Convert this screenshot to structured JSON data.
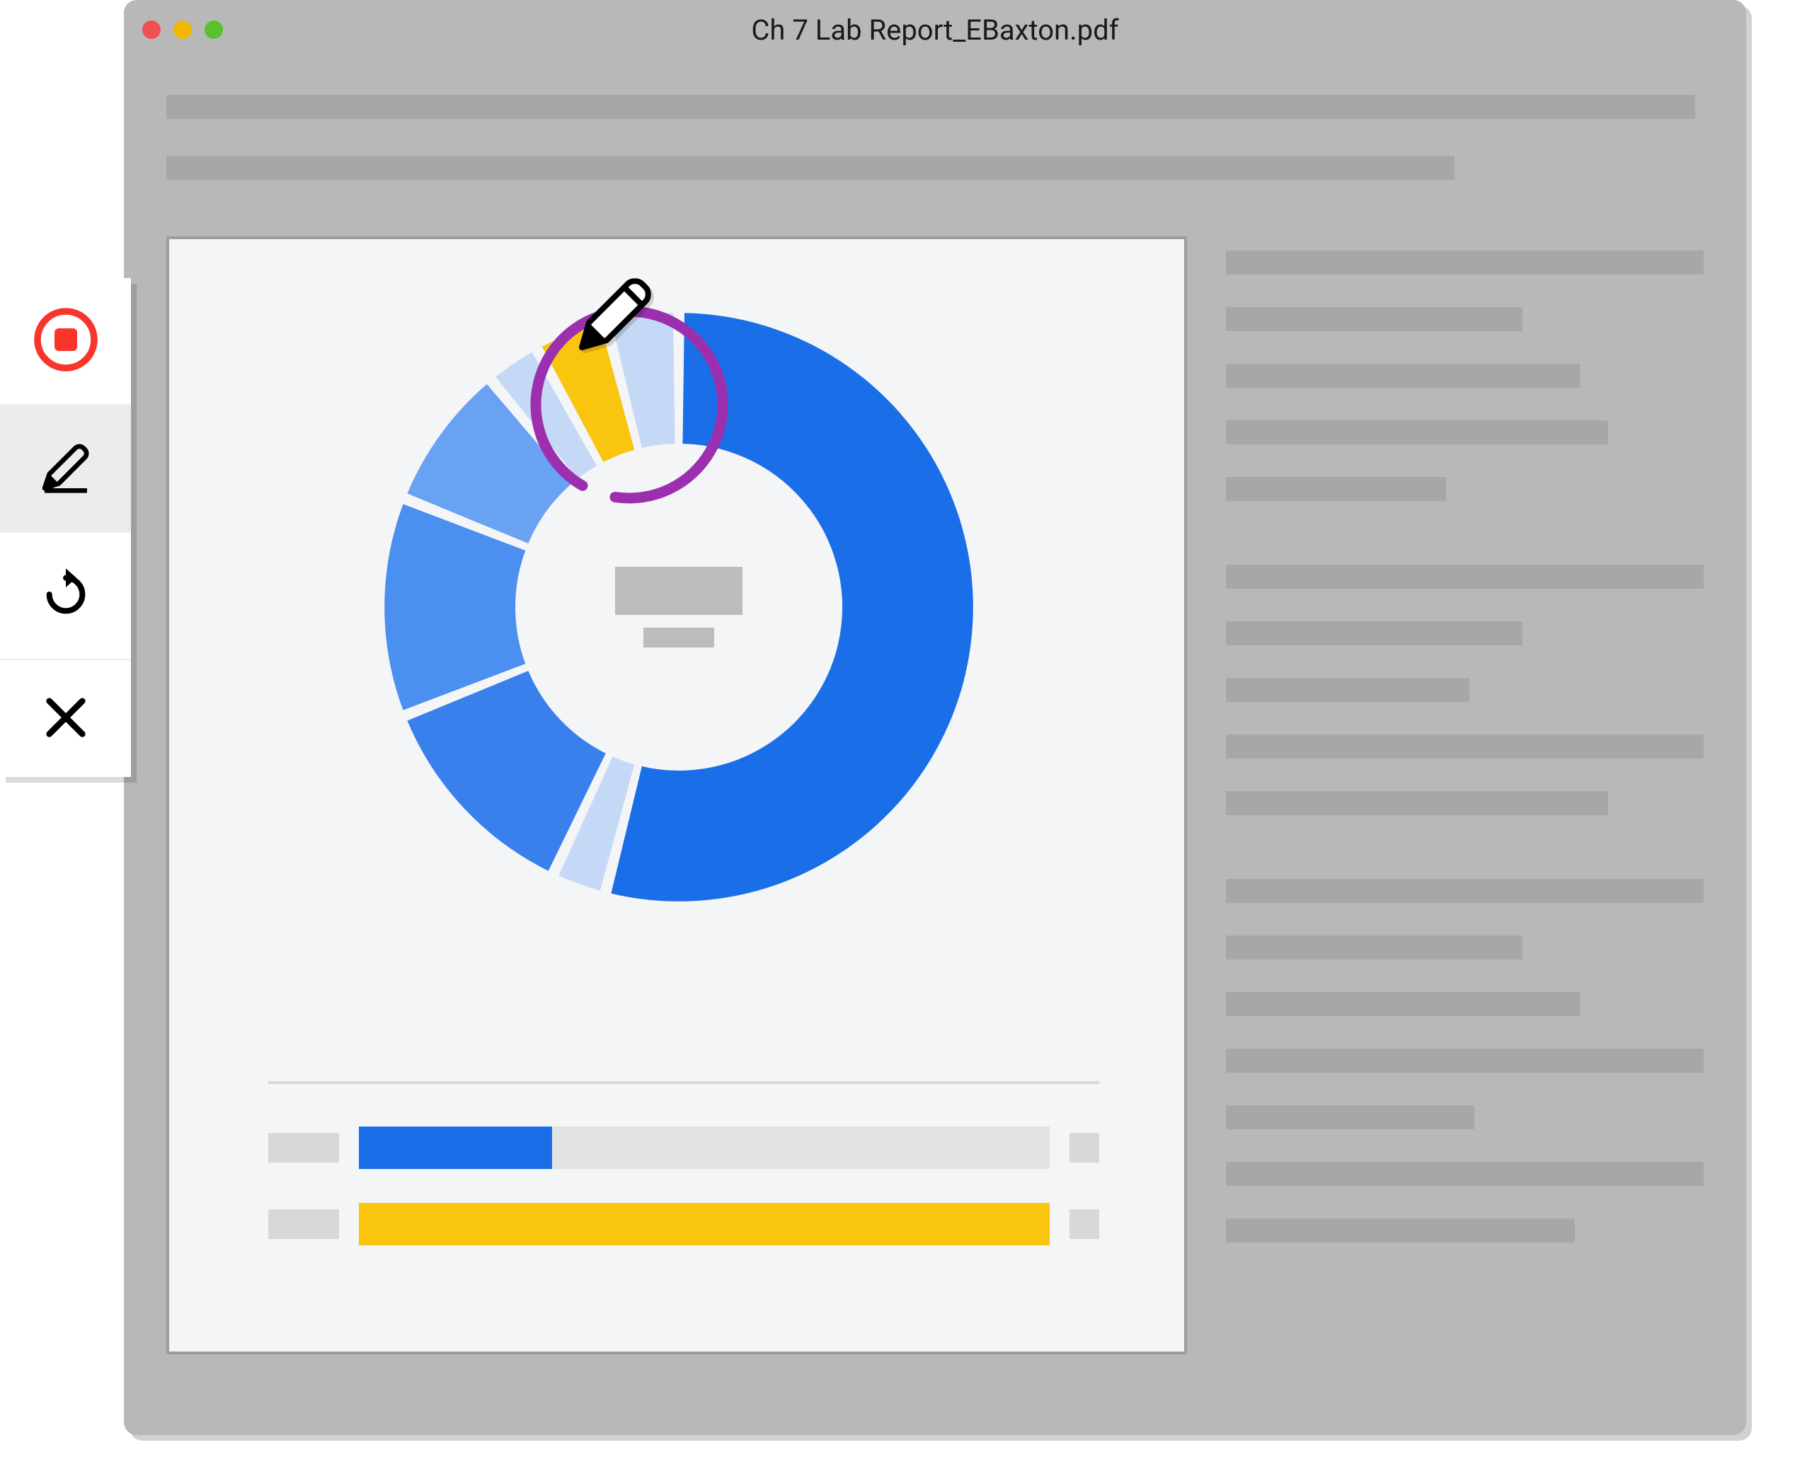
{
  "window": {
    "title": "Ch 7 Lab Report_EBaxton.pdf",
    "traffic_lights": {
      "red": "#ed5150",
      "yellow": "#f2b700",
      "green": "#57c22d"
    }
  },
  "toolbar": {
    "tools": [
      {
        "name": "stop-record",
        "icon": "stop-circle-icon",
        "active": false,
        "color": "#f8352b"
      },
      {
        "name": "pencil",
        "icon": "pencil-icon",
        "active": true,
        "color": "#000000"
      },
      {
        "name": "redo",
        "icon": "redo-icon",
        "active": false,
        "color": "#000000"
      },
      {
        "name": "close",
        "icon": "x-icon",
        "active": false,
        "color": "#000000"
      }
    ]
  },
  "annotation": {
    "stroke_color": "#9b2fae",
    "icon": "pencil-icon"
  },
  "chart_data": {
    "type": "donut",
    "title": "",
    "series": [
      {
        "name": "seg-1",
        "value": 54,
        "color": "#1a6fe8"
      },
      {
        "name": "seg-2",
        "value": 3,
        "color": "#c5d9f7"
      },
      {
        "name": "seg-3",
        "value": 12,
        "color": "#3a80ec"
      },
      {
        "name": "seg-4",
        "value": 12,
        "color": "#4b8ff0"
      },
      {
        "name": "seg-5",
        "value": 8,
        "color": "#6aa2f3"
      },
      {
        "name": "seg-6",
        "value": 3,
        "color": "#c5d9f7"
      },
      {
        "name": "seg-7",
        "value": 4,
        "color": "#f9c50e"
      },
      {
        "name": "seg-8",
        "value": 4,
        "color": "#c5d9f7"
      }
    ],
    "bars": [
      {
        "label": "",
        "value": 28,
        "max": 100,
        "color": "#1a6fe8"
      },
      {
        "label": "",
        "value": 100,
        "max": 100,
        "color": "#f9c50e"
      }
    ]
  }
}
